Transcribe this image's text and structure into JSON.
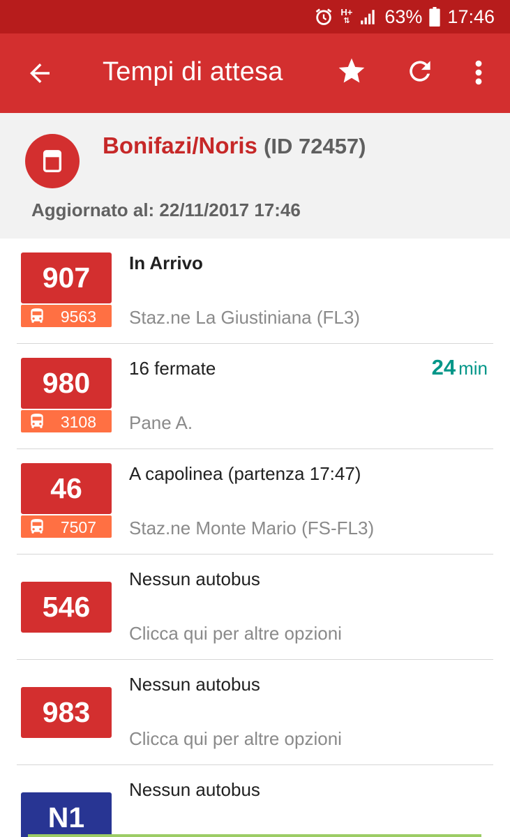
{
  "status_bar": {
    "network": "H+",
    "battery_percent": "63%",
    "time": "17:46"
  },
  "app_bar": {
    "title": "Tempi di attesa",
    "icons": [
      "arrow-back-icon",
      "star-icon",
      "refresh-icon",
      "more-vert-icon"
    ]
  },
  "stop": {
    "name": "Bonifazi/Noris",
    "id_text": "(ID 72457)",
    "updated": "Aggiornato al: 22/11/2017 17:46"
  },
  "colors": {
    "primary": "#d32f2f",
    "primary_dark": "#b71c1c",
    "vehicle_badge": "#ff7043",
    "night_route": "#283593",
    "eta": "#009688"
  },
  "arrivals": [
    {
      "route": "907",
      "vehicle": "9563",
      "status": "In Arrivo",
      "destination": "Staz.ne La Giustiniana (FL3)",
      "eta_value": "",
      "eta_unit": ""
    },
    {
      "route": "980",
      "vehicle": "3108",
      "status": "16 fermate",
      "destination": "Pane A.",
      "eta_value": "24",
      "eta_unit": "min"
    },
    {
      "route": "46",
      "vehicle": "7507",
      "status": "A capolinea (partenza 17:47)",
      "destination": "Staz.ne Monte Mario (FS-FL3)",
      "eta_value": "",
      "eta_unit": ""
    },
    {
      "route": "546",
      "vehicle": "",
      "status": "Nessun autobus",
      "destination": "Clicca qui per altre opzioni",
      "eta_value": "",
      "eta_unit": ""
    },
    {
      "route": "983",
      "vehicle": "",
      "status": "Nessun autobus",
      "destination": "Clicca qui per altre opzioni",
      "eta_value": "",
      "eta_unit": ""
    },
    {
      "route": "N1",
      "vehicle": "",
      "status": "Nessun autobus",
      "destination": "",
      "eta_value": "",
      "eta_unit": ""
    }
  ]
}
